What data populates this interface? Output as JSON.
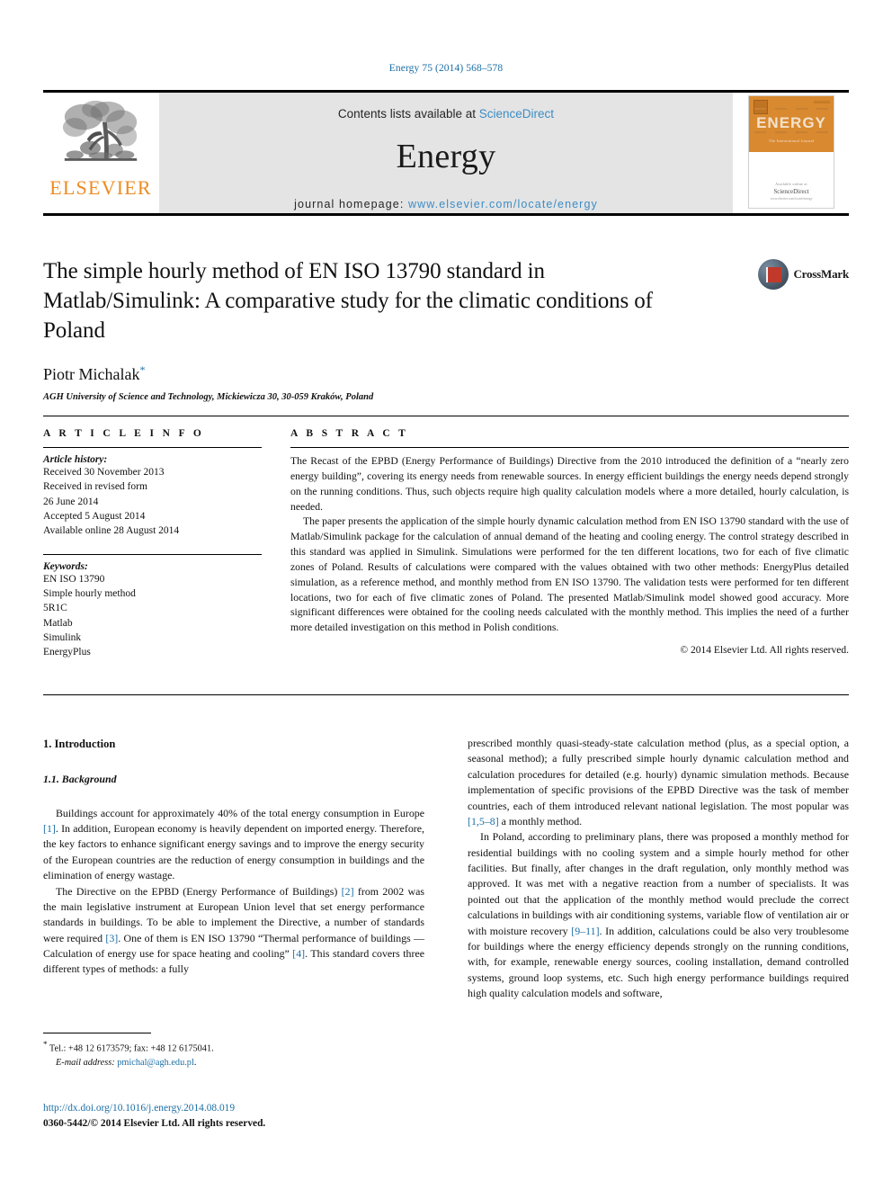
{
  "running_head": "Energy 75 (2014) 568–578",
  "masthead": {
    "publisher_name": "ELSEVIER",
    "contents_prefix": "Contents lists available at",
    "contents_link": "ScienceDirect",
    "journal_name": "Energy",
    "homepage_prefix": "journal homepage:",
    "homepage_url": "www.elsevier.com/locate/energy",
    "cover": {
      "title": "ENERGY",
      "subtitle": "The International Journal",
      "footer_small": "Available online at",
      "footer_brand": "ScienceDirect",
      "footer_tiny": "www.elsevier.com/locate/energy"
    }
  },
  "article": {
    "title": "The simple hourly method of EN ISO 13790 standard in Matlab/Simulink: A comparative study for the climatic conditions of Poland",
    "author": "Piotr Michalak",
    "author_marker": "*",
    "affiliation": "AGH University of Science and Technology, Mickiewicza 30, 30-059 Kraków, Poland",
    "crossmark_label": "CrossMark"
  },
  "article_info": {
    "heading": "A R T I C L E   I N F O",
    "history_label": "Article history:",
    "history": [
      "Received 30 November 2013",
      "Received in revised form",
      "26 June 2014",
      "Accepted 5 August 2014",
      "Available online 28 August 2014"
    ],
    "keywords_label": "Keywords:",
    "keywords": [
      "EN ISO 13790",
      "Simple hourly method",
      "5R1C",
      "Matlab",
      "Simulink",
      "EnergyPlus"
    ]
  },
  "abstract": {
    "heading": "A B S T R A C T",
    "paragraphs": [
      "The Recast of the EPBD (Energy Performance of Buildings) Directive from the 2010 introduced the definition of a “nearly zero energy building”, covering its energy needs from renewable sources. In energy efficient buildings the energy needs depend strongly on the running conditions. Thus, such objects require high quality calculation models where a more detailed, hourly calculation, is needed.",
      "The paper presents the application of the simple hourly dynamic calculation method from EN ISO 13790 standard with the use of Matlab/Simulink package for the calculation of annual demand of the heating and cooling energy. The control strategy described in this standard was applied in Simulink. Simulations were performed for the ten different locations, two for each of five climatic zones of Poland. Results of calculations were compared with the values obtained with two other methods: EnergyPlus detailed simulation, as a reference method, and monthly method from EN ISO 13790. The validation tests were performed for ten different locations, two for each of five climatic zones of Poland. The presented Matlab/Simulink model showed good accuracy. More significant differences were obtained for the cooling needs calculated with the monthly method. This implies the need of a further more detailed investigation on this method in Polish conditions."
    ],
    "copyright": "© 2014 Elsevier Ltd. All rights reserved."
  },
  "body": {
    "section_heading": "1. Introduction",
    "subsection_heading": "1.1. Background",
    "left_paragraphs": [
      "Buildings account for approximately 40% of the total energy consumption in Europe [1]. In addition, European economy is heavily dependent on imported energy. Therefore, the key factors to enhance significant energy savings and to improve the energy security of the European countries are the reduction of energy consumption in buildings and the elimination of energy wastage.",
      "The Directive on the EPBD (Energy Performance of Buildings) [2] from 2002 was the main legislative instrument at European Union level that set energy performance standards in buildings. To be able to implement the Directive, a number of standards were required [3]. One of them is EN ISO 13790 “Thermal performance of buildings — Calculation of energy use for space heating and cooling” [4]. This standard covers three different types of methods: a fully"
    ],
    "right_paragraphs": [
      "prescribed monthly quasi-steady-state calculation method (plus, as a special option, a seasonal method); a fully prescribed simple hourly dynamic calculation method and calculation procedures for detailed (e.g. hourly) dynamic simulation methods. Because implementation of specific provisions of the EPBD Directive was the task of member countries, each of them introduced relevant national legislation. The most popular was [1,5–8] a monthly method.",
      "In Poland, according to preliminary plans, there was proposed a monthly method for residential buildings with no cooling system and a simple hourly method for other facilities. But finally, after changes in the draft regulation, only monthly method was approved. It was met with a negative reaction from a number of specialists. It was pointed out that the application of the monthly method would preclude the correct calculations in buildings with air conditioning systems, variable flow of ventilation air or with moisture recovery [9–11]. In addition, calculations could be also very troublesome for buildings where the energy efficiency depends strongly on the running conditions, with, for example, renewable energy sources, cooling installation, demand controlled systems, ground loop systems, etc. Such high energy performance buildings required high quality calculation models and software,"
    ]
  },
  "footnote": {
    "marker": "*",
    "contact": "Tel.: +48 12 6173579; fax: +48 12 6175041.",
    "email_label": "E-mail address:",
    "email": "pmichal@agh.edu.pl"
  },
  "footer": {
    "doi": "http://dx.doi.org/10.1016/j.energy.2014.08.019",
    "issn_line": "0360-5442/© 2014 Elsevier Ltd. All rights reserved."
  },
  "colors": {
    "link_blue": "#1b6ea5",
    "elsevier_orange": "#ec8b22",
    "band_grey": "#e4e4e4"
  }
}
